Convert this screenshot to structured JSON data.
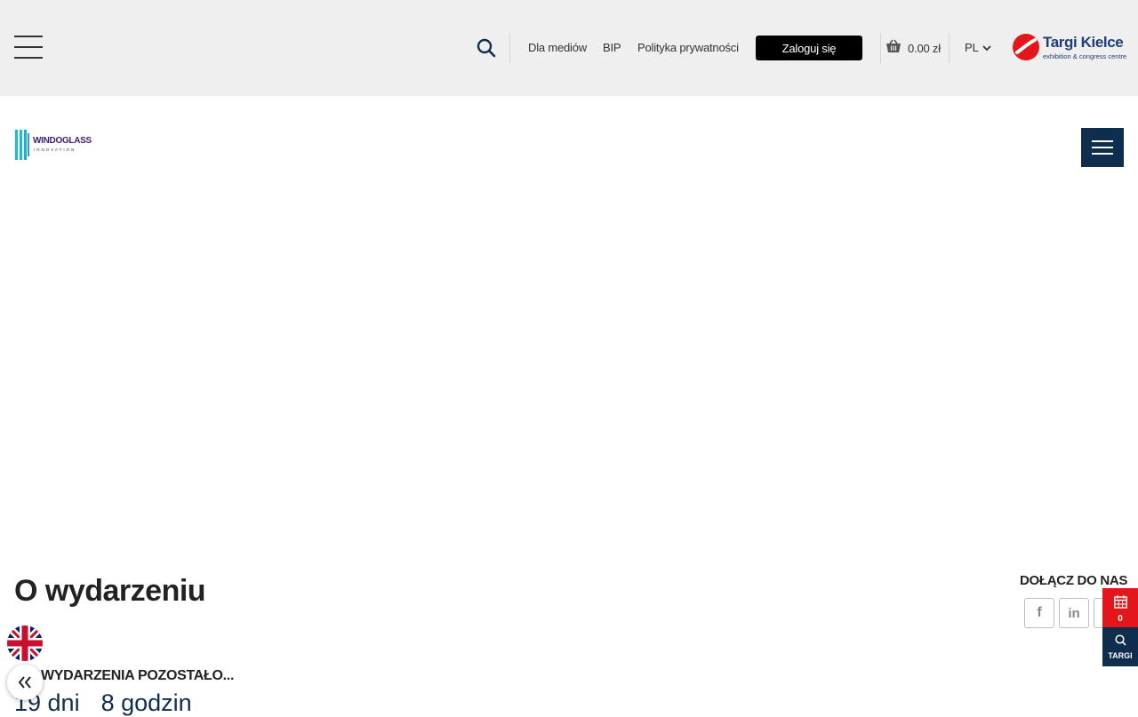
{
  "topbar": {
    "links": [
      "Dla mediów",
      "BIP",
      "Polityka prywatności"
    ],
    "login_label": "Zaloguj się",
    "cart_total": "0.00 zł",
    "language": "PL",
    "brand": {
      "name": "Targi Kielce",
      "tagline": "exhibition & congress centre"
    }
  },
  "header": {
    "event_logo": {
      "title": "WINDOGLASS",
      "subtitle": "INNOVATION"
    }
  },
  "main": {
    "section_title": "O wydarzeniu",
    "countdown_label": "WYDARZENIA POZOSTAŁO...",
    "countdown_days": "19 dni",
    "countdown_hours": "8 godzin"
  },
  "social": {
    "label": "DOŁĄCZ DO NAS",
    "items": [
      "facebook-icon",
      "linkedin-icon",
      "instagram-icon"
    ]
  },
  "side_panel": {
    "calendar_count": "0",
    "targi_label": "TARGI"
  },
  "colors": {
    "navy": "#0f2d4c",
    "red": "#e2161b",
    "topbar_bg": "#efefef"
  }
}
